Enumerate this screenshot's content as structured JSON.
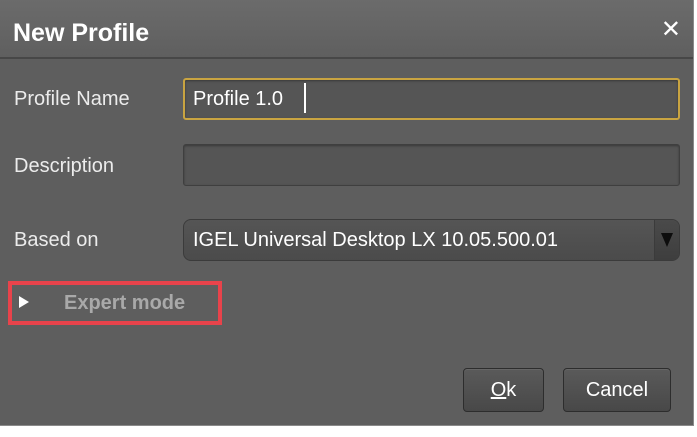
{
  "dialog": {
    "title": "New Profile",
    "close_glyph": "✕"
  },
  "form": {
    "profile_name": {
      "label": "Profile Name",
      "value": "Profile 1.0"
    },
    "description": {
      "label": "Description",
      "value": ""
    },
    "based_on": {
      "label": "Based on",
      "value": "IGEL Universal Desktop LX 10.05.500.01"
    }
  },
  "expert_mode": {
    "label": "Expert mode",
    "expanded": false,
    "highlight_color": "#e8434b"
  },
  "buttons": {
    "ok_mnemonic": "O",
    "ok_rest": "k",
    "cancel_label": "Cancel"
  },
  "colors": {
    "dialog_bg": "#5e5e5e",
    "focus_border": "#c9a441",
    "text": "#ffffff"
  }
}
